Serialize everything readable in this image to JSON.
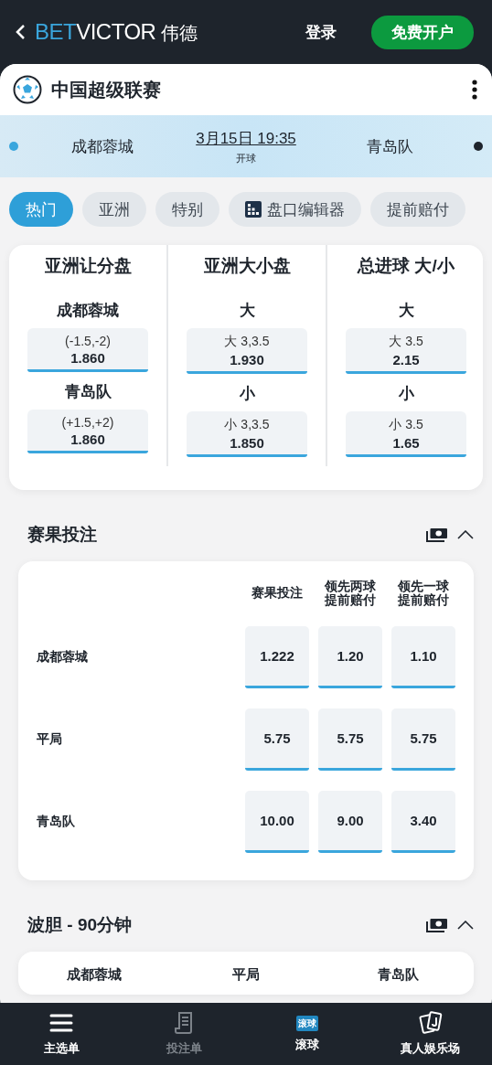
{
  "header": {
    "brand": {
      "part_1": "BET",
      "part_2": "VICTOR",
      "suffix": "伟德"
    },
    "login": "登录",
    "signup": "免费开户"
  },
  "league": {
    "title": "中国超级联赛"
  },
  "match": {
    "teams": [
      {
        "name": "成都蓉城",
        "color": "#3aa6dd"
      },
      {
        "name": "青岛队",
        "color": "#1e242c"
      }
    ],
    "time": "3月15日 19:35",
    "status": "开球"
  },
  "tabs": [
    {
      "label": "热门",
      "selected": true,
      "kind": "plain"
    },
    {
      "label": "亚洲",
      "selected": false,
      "kind": "plain"
    },
    {
      "label": "特别",
      "selected": false,
      "kind": "plain"
    },
    {
      "label": "盘口编辑器",
      "selected": false,
      "kind": "builder"
    },
    {
      "label": "提前赔付",
      "selected": false,
      "kind": "plain"
    }
  ],
  "main_markets": [
    {
      "title": "亚洲让分盘",
      "selections": [
        {
          "label": "成都蓉城",
          "line": "(-1.5,-2)",
          "odds": "1.860"
        },
        {
          "label": "青岛队",
          "line": "(+1.5,+2)",
          "odds": "1.860"
        }
      ]
    },
    {
      "title": "亚洲大小盘",
      "selections": [
        {
          "label": "大",
          "line": "大 3,3.5",
          "odds": "1.930"
        },
        {
          "label": "小",
          "line": "小 3,3.5",
          "odds": "1.850"
        }
      ]
    },
    {
      "title": "总进球 大/小",
      "selections": [
        {
          "label": "大",
          "line": "大 3.5",
          "odds": "2.15"
        },
        {
          "label": "小",
          "line": "小 3.5",
          "odds": "1.65"
        }
      ]
    }
  ],
  "sections": [
    {
      "title": "赛果投注",
      "expanded": true,
      "kind": "table",
      "columns": [
        "赛果投注",
        "领先两球提前赔付",
        "领先一球提前赔付"
      ],
      "rows": [
        {
          "label": "成都蓉城",
          "odds": [
            "1.222",
            "1.20",
            "1.10"
          ]
        },
        {
          "label": "平局",
          "odds": [
            "5.75",
            "5.75",
            "5.75"
          ]
        },
        {
          "label": "青岛队",
          "odds": [
            "10.00",
            "9.00",
            "3.40"
          ]
        }
      ]
    },
    {
      "title": "波胆 - 90分钟",
      "expanded": true,
      "kind": "columns",
      "columns": [
        "成都蓉城",
        "平局",
        "青岛队"
      ]
    }
  ],
  "nav": [
    {
      "label": "主选单",
      "kind": "menu",
      "disabled": false
    },
    {
      "label": "投注单",
      "kind": "betslip",
      "disabled": true
    },
    {
      "label": "滚球",
      "kind": "live",
      "badge": "滚球",
      "disabled": false
    },
    {
      "label": "真人娱乐场",
      "kind": "casino",
      "disabled": false
    }
  ]
}
